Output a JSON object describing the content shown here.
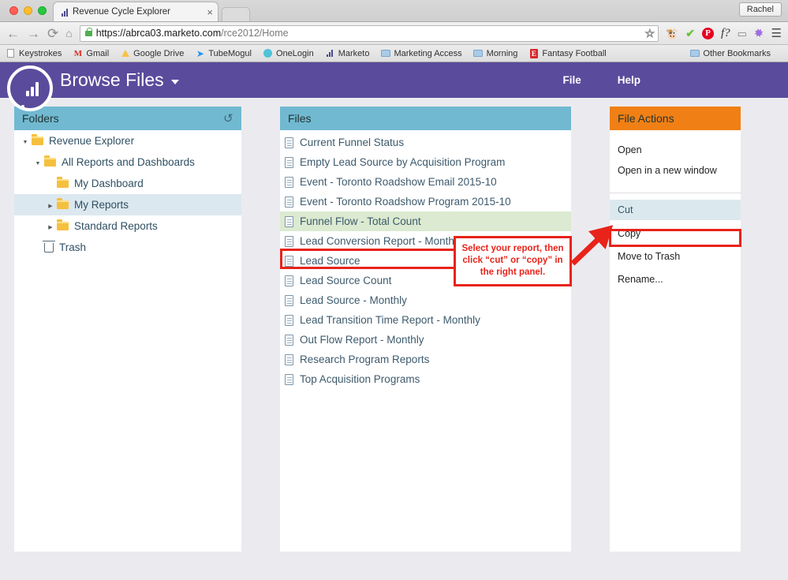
{
  "browser": {
    "tab": {
      "title": "Revenue Cycle Explorer",
      "close_label": "×",
      "favicon": "bar-chart-icon"
    },
    "profile_button": "Rachel",
    "nav": {
      "back": "←",
      "forward": "→",
      "reload": "⟳",
      "home": "⌂"
    },
    "url": {
      "scheme": "https://",
      "host": "abrca03.marketo.com",
      "path": "/rce2012/Home",
      "lock": "lock-icon",
      "star": "☆"
    },
    "extensions": [
      {
        "name": "evernote-icon",
        "glyph": "🐘"
      },
      {
        "name": "check-icon",
        "glyph": "✔"
      },
      {
        "name": "pinterest-icon",
        "glyph": "P"
      },
      {
        "name": "fontface-icon",
        "glyph": "f?"
      },
      {
        "name": "cast-icon",
        "glyph": "▭"
      },
      {
        "name": "feather-icon",
        "glyph": "╱"
      },
      {
        "name": "chrome-menu-icon",
        "glyph": "☰"
      }
    ],
    "bookmarks": [
      {
        "label": "Keystrokes",
        "icon": "page-icon"
      },
      {
        "label": "Gmail",
        "icon": "gmail-icon"
      },
      {
        "label": "Google Drive",
        "icon": "google-drive-icon"
      },
      {
        "label": "TubeMogul",
        "icon": "tubemogul-icon"
      },
      {
        "label": "OneLogin",
        "icon": "onelogin-icon"
      },
      {
        "label": "Marketo",
        "icon": "marketo-icon"
      },
      {
        "label": "Marketing Access",
        "icon": "folder-icon"
      },
      {
        "label": "Morning",
        "icon": "folder-icon"
      },
      {
        "label": "Fantasy Football",
        "icon": "espn-icon"
      }
    ],
    "other_bookmarks": {
      "label": "Other Bookmarks",
      "icon": "folder-icon"
    }
  },
  "app": {
    "title": "Browse Files",
    "title_caret": "▾",
    "logo": "marketo-revenue-explorer-logo",
    "menu": [
      {
        "label": "File"
      },
      {
        "label": "Help"
      }
    ]
  },
  "folders": {
    "header": "Folders",
    "refresh_icon": "refresh-icon",
    "tree": [
      {
        "label": "Revenue Explorer",
        "indent": 0,
        "twisty": "open",
        "icon": "folder-icon",
        "selected": false
      },
      {
        "label": "All Reports and Dashboards",
        "indent": 1,
        "twisty": "open",
        "icon": "folder-icon",
        "selected": false
      },
      {
        "label": "My Dashboard",
        "indent": 2,
        "twisty": "none",
        "icon": "folder-icon",
        "selected": false
      },
      {
        "label": "My Reports",
        "indent": 2,
        "twisty": "closed",
        "icon": "folder-icon",
        "selected": true
      },
      {
        "label": "Standard Reports",
        "indent": 2,
        "twisty": "closed",
        "icon": "folder-icon",
        "selected": false
      },
      {
        "label": "Trash",
        "indent": 1,
        "twisty": "none",
        "icon": "trash-icon",
        "selected": false
      }
    ]
  },
  "files": {
    "header": "Files",
    "items": [
      {
        "label": "Current Funnel Status",
        "selected": false
      },
      {
        "label": "Empty Lead Source by Acquisition Program",
        "selected": false
      },
      {
        "label": "Event - Toronto Roadshow Email 2015-10",
        "selected": false
      },
      {
        "label": "Event - Toronto Roadshow Program 2015-10",
        "selected": false
      },
      {
        "label": "Funnel Flow - Total Count",
        "selected": true
      },
      {
        "label": "Lead Conversion Report - Monthly",
        "selected": false
      },
      {
        "label": "Lead Source",
        "selected": false
      },
      {
        "label": "Lead Source Count",
        "selected": false
      },
      {
        "label": "Lead Source - Monthly",
        "selected": false
      },
      {
        "label": "Lead Transition Time Report - Monthly",
        "selected": false
      },
      {
        "label": "Out Flow Report - Monthly",
        "selected": false
      },
      {
        "label": "Research Program Reports",
        "selected": false
      },
      {
        "label": "Top Acquisition Programs",
        "selected": false
      }
    ]
  },
  "file_actions": {
    "header": "File Actions",
    "group_one": [
      {
        "label": "Open",
        "highlighted": false
      },
      {
        "label": "Open in a new window",
        "highlighted": false
      }
    ],
    "group_two": [
      {
        "label": "Cut",
        "highlighted": true
      },
      {
        "label": "Copy",
        "highlighted": false
      },
      {
        "label": "Move to Trash",
        "highlighted": false
      },
      {
        "label": "Rename...",
        "highlighted": false
      }
    ]
  },
  "annotations": {
    "callout_line1": "Select your report, then",
    "callout_line2": "click “cut” or “copy” in",
    "callout_line3": "the right panel.",
    "highlight_color": "#e8231a",
    "arrow": "red-arrow-pointing-to-cut"
  },
  "colors": {
    "app_purple": "#5b4b9c",
    "panel_header_teal": "#71b9d1",
    "actions_header_orange": "#f08015",
    "selected_file_green": "#dbead0",
    "selected_row_blue": "#dce8ef",
    "annotation_red": "#e8231a"
  }
}
